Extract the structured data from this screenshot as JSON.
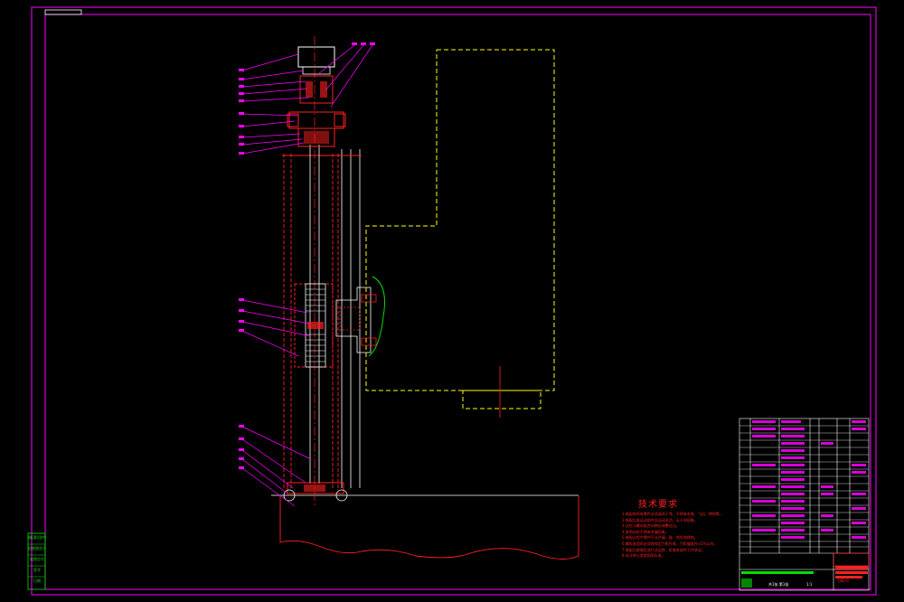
{
  "drawing": {
    "tech_requirements_title": "技术要求",
    "tech_notes": [
      "1.装配前所有零件必须清洗干净，不得有毛刺、飞边、锈蚀等。",
      "2.装配后各运动部件应运动灵活，无卡滞现象。",
      "3.丝杠与螺母配合间隙应调整适当。",
      "4.各密封处不得有渗漏现象。",
      "5.装配过程中零件不允许磕、碰、划伤和锈蚀。",
      "6.螺栓紧固时必须按规定力矩拧紧，力矩偏差在±5%以内。",
      "7.装配后按规定进行试运转，检查各部件工作状况。",
      "8.未注明公差按国家标准。"
    ],
    "title_block": {
      "drawing_number": "YJ00-0",
      "scale": "1:1",
      "sheet": "共1张 第1张"
    },
    "left_side_table": [
      "借(通)用件登记",
      "旧底图总号",
      "底图总号",
      "签字",
      "日期"
    ]
  },
  "colors": {
    "background": "#000000",
    "frame": "#ff00ff",
    "part": "#ff2020",
    "hidden": "#ffff00",
    "center": "#ff2020",
    "leader": "#ff00ff",
    "white_line": "#ffffff",
    "green_line": "#00e000"
  },
  "icons": {
    "balloon_leaders": "leader-line-icon"
  }
}
